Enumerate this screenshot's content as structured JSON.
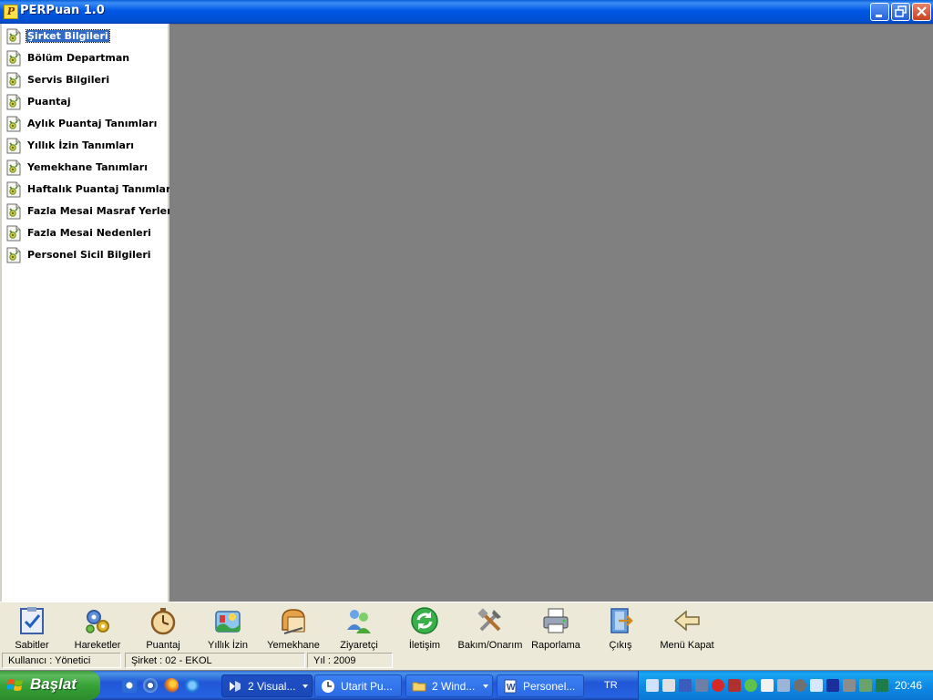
{
  "window": {
    "title": "PERPuan 1.0",
    "app_icon_letter": "P"
  },
  "left_menu": {
    "selected_index": 0,
    "items": [
      "Şirket Bilgileri",
      "Bölüm Departman",
      "Servis Bilgileri",
      "Puantaj",
      "Aylık Puantaj Tanımları",
      "Yıllık İzin Tanımları",
      "Yemekhane Tanımları",
      "Haftalık Puantaj Tanımları",
      "Fazla Mesai Masraf Yerleri",
      "Fazla Mesai Nedenleri",
      "Personel Sicil Bilgileri"
    ]
  },
  "toolbar": {
    "buttons": [
      {
        "label": "Sabitler",
        "icon": "clipboard-check-icon"
      },
      {
        "label": "Hareketler",
        "icon": "gears-icon"
      },
      {
        "label": "Puantaj",
        "icon": "stopwatch-icon"
      },
      {
        "label": "Yıllık İzin",
        "icon": "vacation-icon"
      },
      {
        "label": "Yemekhane",
        "icon": "bread-icon"
      },
      {
        "label": "Ziyaretçi",
        "icon": "visitors-icon"
      },
      {
        "label": "İletişim",
        "icon": "refresh-icon"
      },
      {
        "label": "Bakım/Onarım",
        "icon": "tools-icon"
      },
      {
        "label": "Raporlama",
        "icon": "printer-icon"
      },
      {
        "label": "Çıkış",
        "icon": "exit-door-icon"
      },
      {
        "label": "Menü Kapat",
        "icon": "back-arrow-icon"
      }
    ]
  },
  "status": {
    "user": "Kullanıcı : Yönetici",
    "company": "Şirket : 02 - EKOL",
    "year": "Yıl : 2009"
  },
  "taskbar": {
    "start_label": "Başlat",
    "tasks": [
      {
        "label": "2 Visual...",
        "has_arrow": true,
        "active": true
      },
      {
        "label": "Utarit Pu...",
        "has_arrow": false,
        "active": false
      },
      {
        "label": "2 Wind...",
        "has_arrow": true,
        "active": false
      },
      {
        "label": "Personel...",
        "has_arrow": false,
        "active": false
      }
    ],
    "language": "TR",
    "clock": "20:46"
  },
  "colors": {
    "title_bar": "#0058e6",
    "selection": "#316ac5",
    "mdi_background": "#808080",
    "toolbar_bg": "#ece9d8",
    "taskbar": "#2157d7",
    "start_button": "#37a337"
  }
}
